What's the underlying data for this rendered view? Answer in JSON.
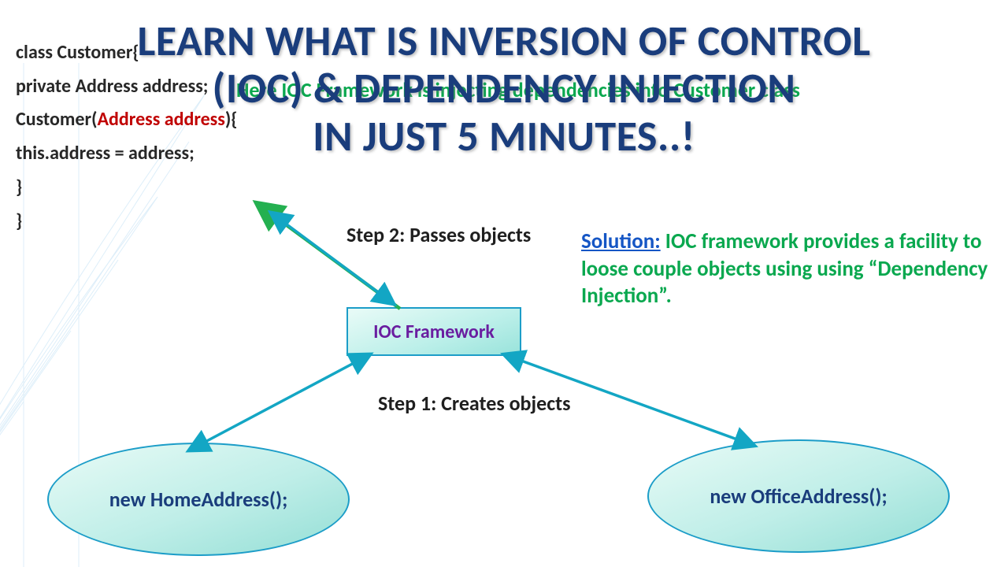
{
  "title_lines": {
    "l1": "LEARN WHAT IS INVERSION OF CONTROL",
    "l2": "(IOC) & DEPENDENCY INJECTION",
    "l3": "IN JUST 5 MINUTES..!"
  },
  "green_caption": "Here IOC Framework is injecting dependencies into Customer class",
  "code": {
    "line1": "class Customer{",
    "line2": "private Address address;",
    "line3_a": "Customer(",
    "line3_b": "Address address",
    "line3_c": "){",
    "line4": "this.address = address;",
    "line5": "}",
    "line6": "}"
  },
  "steps": {
    "step1": "Step 1: Creates objects",
    "step2": "Step 2: Passes objects"
  },
  "solution": {
    "label": "Solution:",
    "body": "  IOC framework provides a facility to loose couple objects using using “Dependency Injection”."
  },
  "nodes": {
    "ioc": "IOC Framework",
    "home": "new HomeAddress();",
    "office": "new OfficeAddress();"
  },
  "colors": {
    "title": "#1a3d7c",
    "green": "#0aa84f",
    "red": "#c00000",
    "link_blue": "#1556c5",
    "node_text": "#6a1ea0",
    "arrow_green": "#24b050",
    "arrow_teal": "#13a6c4"
  }
}
